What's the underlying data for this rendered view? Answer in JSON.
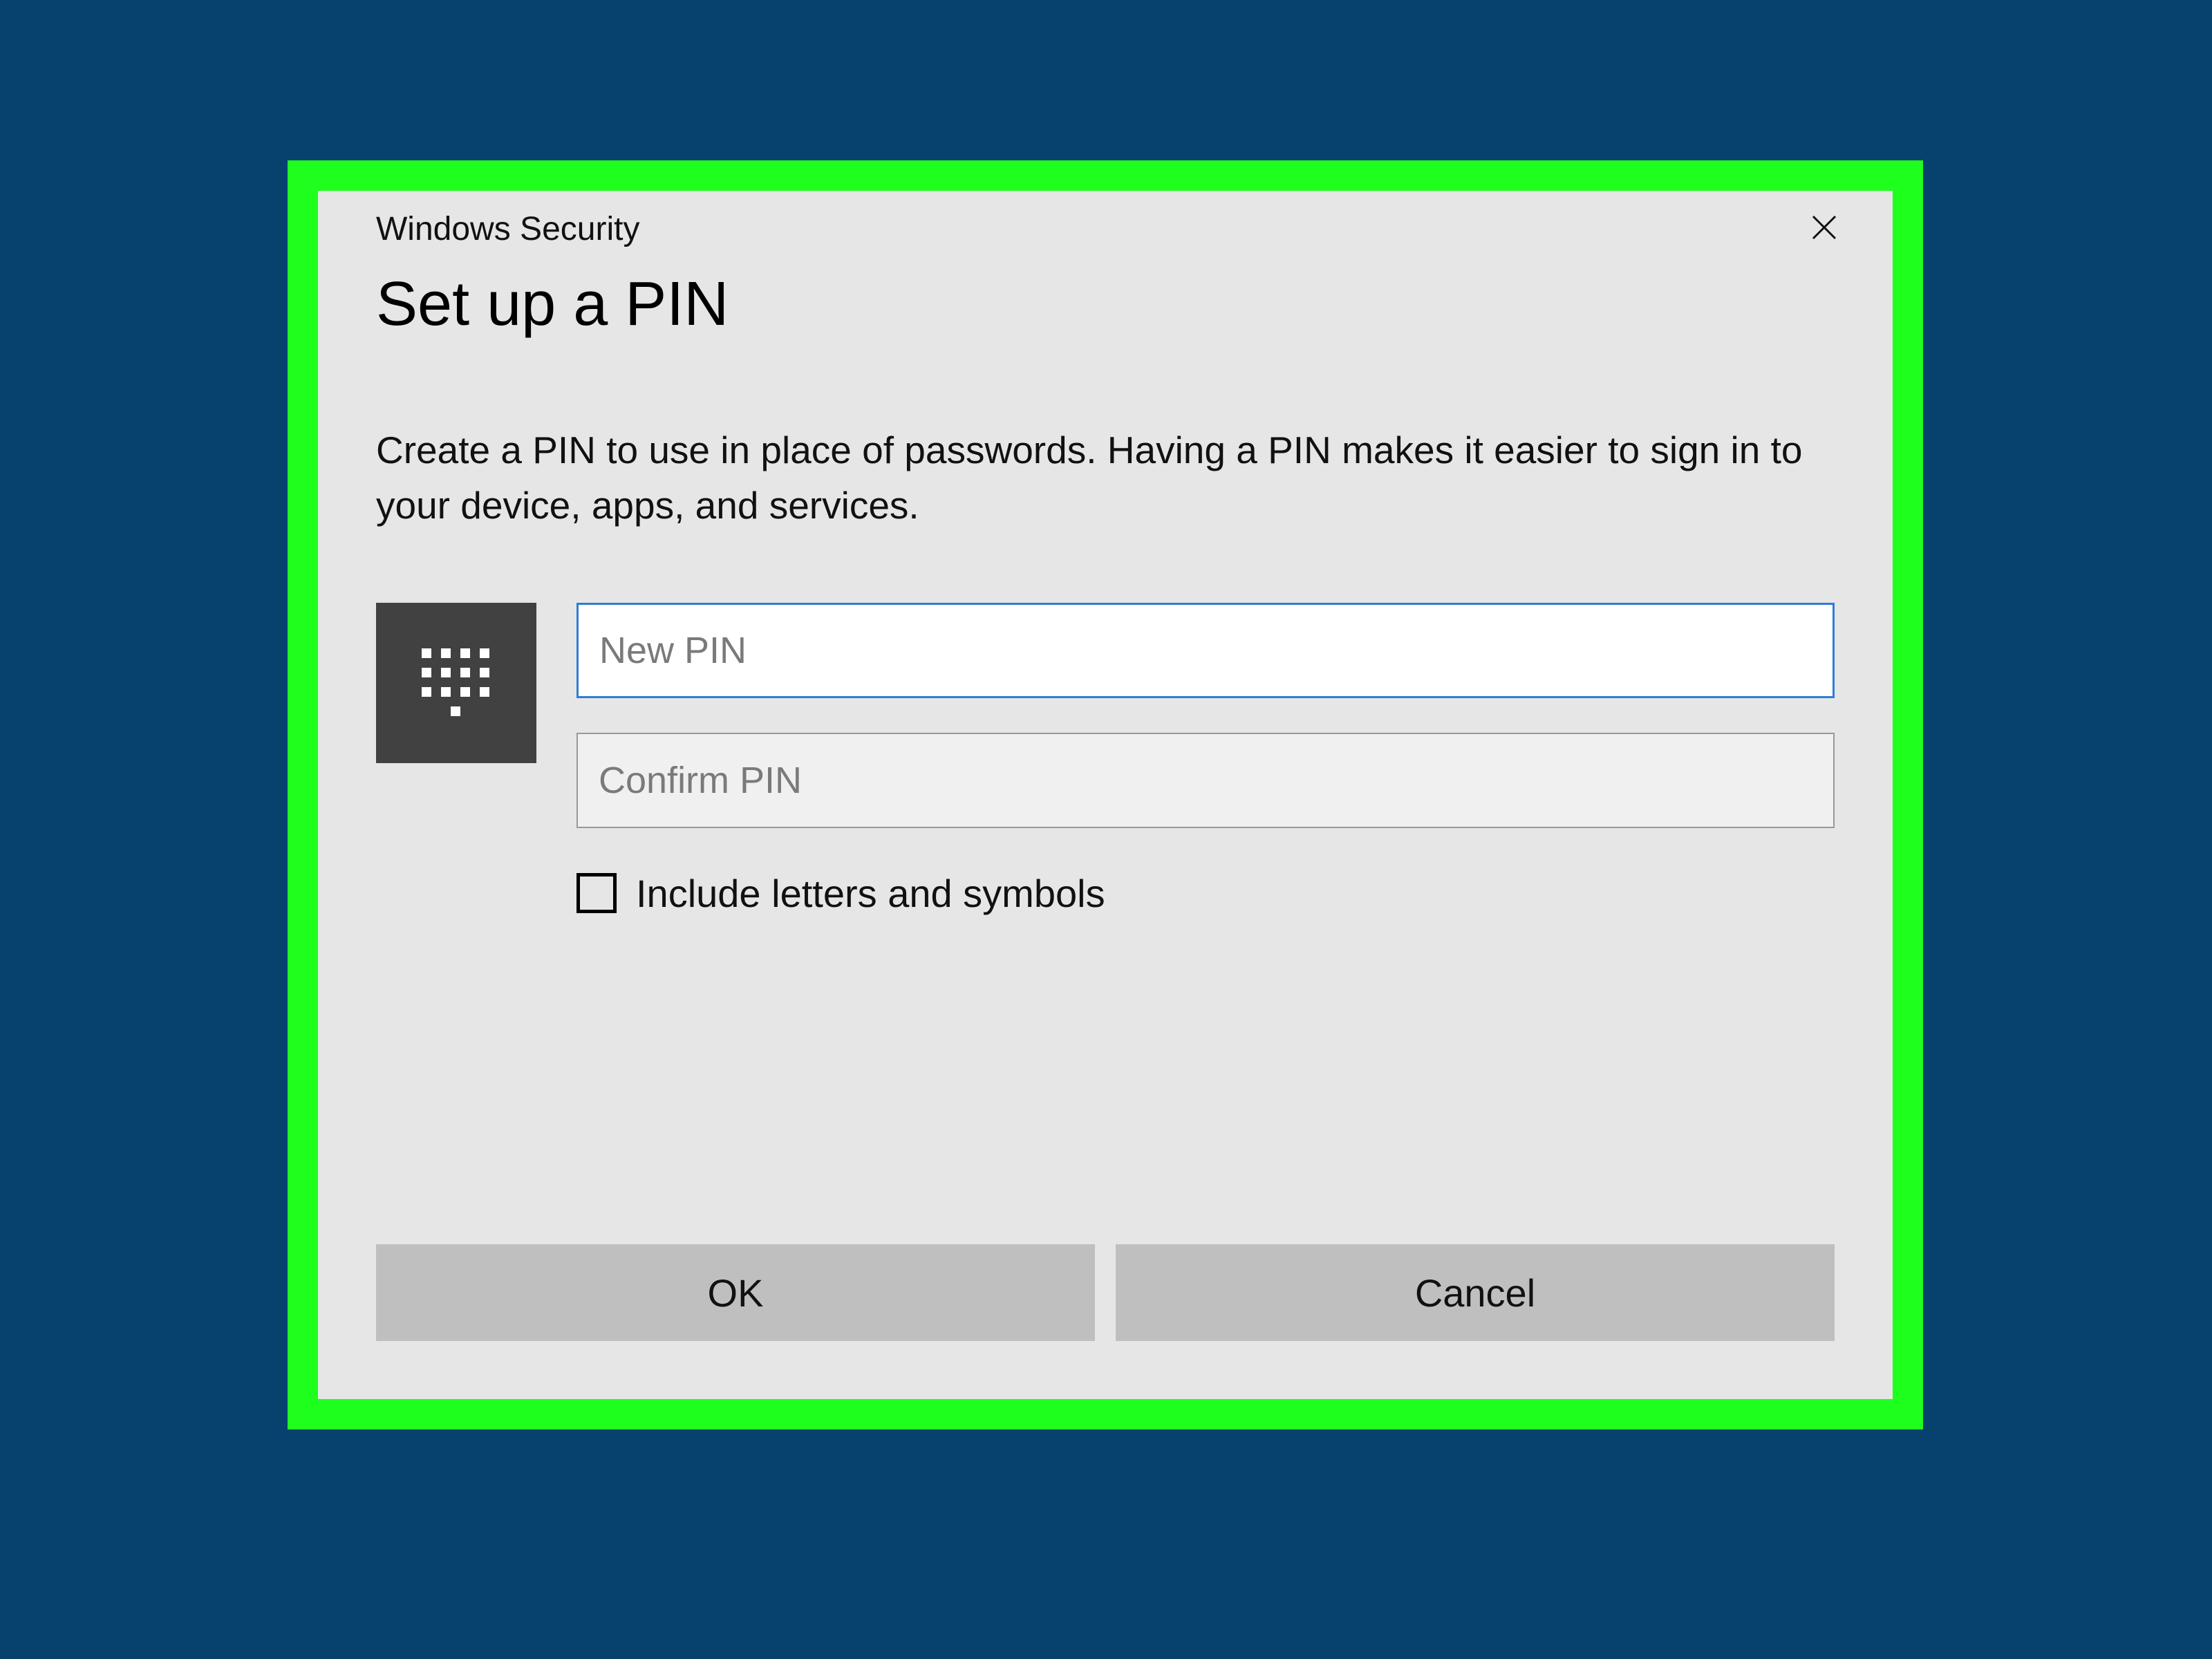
{
  "dialog": {
    "app_title": "Windows Security",
    "heading": "Set up a PIN",
    "description": "Create a PIN to use in place of passwords. Having a PIN makes it easier to sign in to your device, apps, and services.",
    "inputs": {
      "new_pin": {
        "placeholder": "New PIN",
        "value": ""
      },
      "confirm_pin": {
        "placeholder": "Confirm PIN",
        "value": ""
      }
    },
    "checkbox": {
      "label": "Include letters and symbols",
      "checked": false
    },
    "buttons": {
      "ok": "OK",
      "cancel": "Cancel"
    },
    "icons": {
      "close": "close-icon",
      "keypad": "keypad-icon"
    }
  }
}
